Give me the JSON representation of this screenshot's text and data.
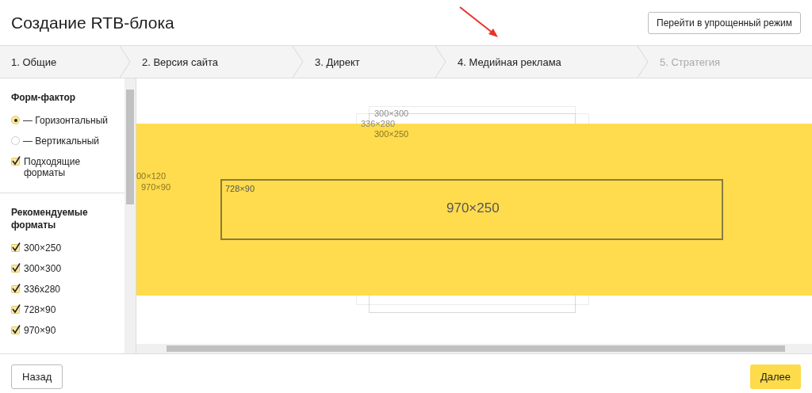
{
  "header": {
    "title": "Создание RTB-блока",
    "simple_mode_button": "Перейти в упрощенный режим"
  },
  "steps": [
    {
      "label": "1. Общие",
      "disabled": false
    },
    {
      "label": "2. Версия сайта",
      "disabled": false
    },
    {
      "label": "3. Директ",
      "disabled": false
    },
    {
      "label": "4. Медийная реклама",
      "disabled": false
    },
    {
      "label": "5. Стратегия",
      "disabled": true
    }
  ],
  "sidebar": {
    "sections": [
      {
        "title": "Форм-фактор",
        "options": [
          {
            "kind": "radio",
            "label": "— Горизонтальный",
            "selected": true
          },
          {
            "kind": "radio",
            "label": "— Вертикальный",
            "selected": false
          },
          {
            "kind": "checkbox",
            "label": "Подходящие форматы",
            "checked": true
          }
        ]
      },
      {
        "title": "Рекомендуемые форматы",
        "options": [
          {
            "kind": "checkbox",
            "label": "300×250",
            "checked": true
          },
          {
            "kind": "checkbox",
            "label": "300×300",
            "checked": true
          },
          {
            "kind": "checkbox",
            "label": "336x280",
            "checked": true
          },
          {
            "kind": "checkbox",
            "label": "728×90",
            "checked": true
          },
          {
            "kind": "checkbox",
            "label": "970×90",
            "checked": true
          }
        ]
      }
    ]
  },
  "preview": {
    "formats": [
      {
        "label": "300×300",
        "kind": "faint"
      },
      {
        "label": "336×280",
        "kind": "faint"
      },
      {
        "label": "300×250",
        "kind": "faint"
      },
      {
        "label": "00×120",
        "kind": "faint"
      },
      {
        "label": "970×90",
        "kind": "faint"
      },
      {
        "label": "970×250",
        "kind": "filled"
      },
      {
        "label": "728×90",
        "kind": "outline"
      }
    ]
  },
  "footer": {
    "back_button": "Назад",
    "next_button": "Далее"
  }
}
